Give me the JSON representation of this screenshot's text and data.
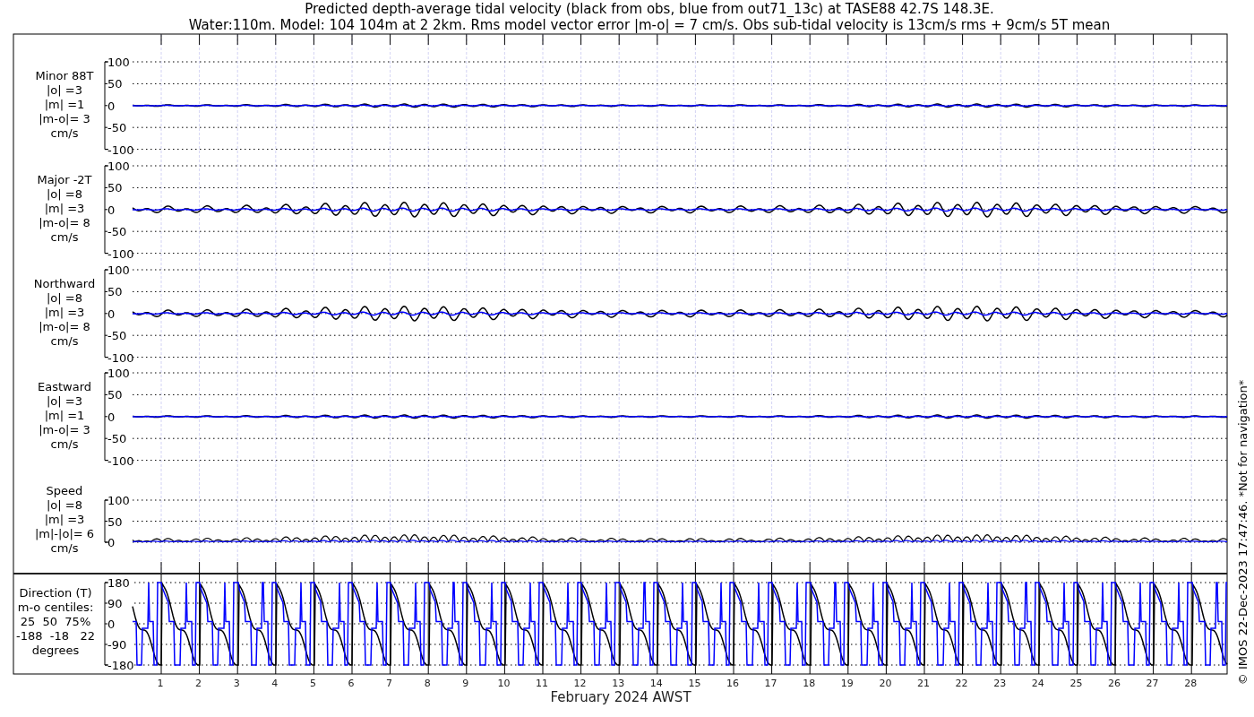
{
  "title_lines": [
    "Predicted depth-average tidal velocity (black from obs, blue from out71_13c) at TASE88 42.7S 148.3E.",
    "Water:110m. Model: 104 104m at 2 2km. Rms model vector error |m-o| = 7 cm/s. Obs sub-tidal velocity is 13cm/s rms + 9cm/s 5T mean"
  ],
  "panels": [
    {
      "kind": "flat",
      "label_lines": [
        "Minor 88T",
        "|o| =3",
        "|m| =1",
        "|m-o|= 3",
        "cm/s"
      ],
      "yticks": [
        "100",
        "50",
        "0",
        "-50",
        "-100"
      ]
    },
    {
      "kind": "wave",
      "label_lines": [
        "Major -2T",
        "|o| =8",
        "|m| =3",
        "|m-o|= 8",
        "cm/s"
      ],
      "yticks": [
        "100",
        "50",
        "0",
        "-50",
        "-100"
      ]
    },
    {
      "kind": "wave",
      "label_lines": [
        "Northward",
        "|o| =8",
        "|m| =3",
        "|m-o|= 8",
        "cm/s"
      ],
      "yticks": [
        "100",
        "50",
        "0",
        "-50",
        "-100"
      ]
    },
    {
      "kind": "flat",
      "label_lines": [
        "Eastward",
        "|o| =3",
        "|m| =1",
        "|m-o|= 3",
        "cm/s"
      ],
      "yticks": [
        "100",
        "50",
        "0",
        "-50",
        "-100"
      ]
    },
    {
      "kind": "speed",
      "label_lines": [
        "Speed",
        "|o| =8",
        "|m| =3",
        "|m|-|o|= 6",
        "cm/s"
      ],
      "yticks": [
        "100",
        "50",
        "0"
      ]
    },
    {
      "kind": "direction",
      "label_lines": [
        "Direction (T)",
        "m-o centiles:",
        "25  50  75%",
        "-188  -18   22",
        "degrees"
      ],
      "yticks": [
        "180",
        "90",
        "0",
        "-90",
        "-180"
      ]
    }
  ],
  "x_axis": {
    "ticks": [
      "1",
      "2",
      "3",
      "4",
      "5",
      "6",
      "7",
      "8",
      "9",
      "10",
      "11",
      "12",
      "13",
      "14",
      "15",
      "16",
      "17",
      "18",
      "19",
      "20",
      "21",
      "22",
      "23",
      "24",
      "25",
      "26",
      "27",
      "28"
    ],
    "label": "February 2024 AWST"
  },
  "credit": "© IMOS 22-Dec-2023 17:47:46. *Not for navigation*"
}
